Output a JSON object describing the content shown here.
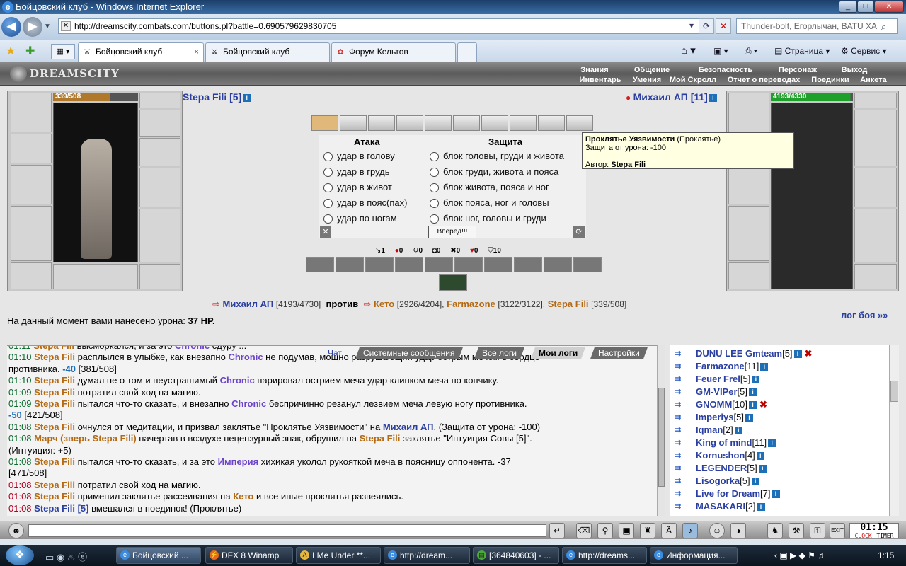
{
  "window": {
    "title": "Бойцовский клуб - Windows Internet Explorer"
  },
  "address": {
    "url": "http://dreamscity.combats.com/buttons.pl?battle=0.690579629830705",
    "search_placeholder": "Thunder-bolt, Егорлычан, BATU ХА"
  },
  "tabs": [
    {
      "label": "Бойцовский клуб",
      "close": "×"
    },
    {
      "label": "Бойцовский клуб"
    },
    {
      "label": "Форум Кельтов"
    }
  ],
  "commands": {
    "page": "Страница",
    "service": "Сервис"
  },
  "game": {
    "logo": "DREAMSCITY",
    "menu_top": [
      "Знания",
      "Общение",
      "Безопасность",
      "Персонаж",
      "Выход"
    ],
    "menu_bottom": [
      "Инвентарь",
      "Умения",
      "Мой Скролл",
      "Отчет о переводах",
      "Поединки",
      "Анкета"
    ],
    "player": {
      "name": "Stepa Fili [5]",
      "hp": "339/508",
      "hp_ratio": 0.667
    },
    "enemy": {
      "name": "Михаил АП [11]",
      "hp": "4193/4330",
      "hp_ratio": 0.968
    },
    "attack_header": "Атака",
    "defense_header": "Защита",
    "attacks": [
      "удар в голову",
      "удар в грудь",
      "удар в живот",
      "удар в пояс(пах)",
      "удар по ногам"
    ],
    "defenses": [
      "блок головы, груди и живота",
      "блок груди, живота и пояса",
      "блок живота, пояса и ног",
      "блок пояса, ног и головы",
      "блок ног, головы и груди"
    ],
    "forward": "Вперёд!!!",
    "stats": [
      "1",
      "0",
      "0",
      "0",
      "0",
      "0",
      "10"
    ],
    "vs": {
      "p1_name": "Михаил АП",
      "p1_hp": "[4193/4730]",
      "versus": "против",
      "p2_name": "Кето",
      "p2_hp": "[2926/4204],",
      "p3_name": "Farmazone",
      "p3_hp": "[3122/3122],",
      "p4_name": "Stepa Fili",
      "p4_hp": "[339/508]"
    },
    "damage_text": "На данный момент вами нанесено урона:",
    "damage_value": "37 HP.",
    "log_link": "лог боя »»",
    "tooltip": {
      "title": "Проклятье Уязвимости",
      "kind": "(Проклятье)",
      "line2": "Защита от урона: -100",
      "author_label": "Автор:",
      "author": "Stepa Fili"
    }
  },
  "chat": {
    "tabs": [
      "Чат",
      "Системные сообщения",
      "Все логи",
      "Мои логи",
      "Настройки"
    ],
    "lines": [
      {
        "time": "01:11",
        "text_a": "Stepa Fili",
        "text_b": " высморкался, и за это ",
        "text_c": "Chronic",
        "text_d": " сдуру ..."
      },
      {
        "time": "01:10",
        "text_a": "Stepa Fili",
        "text_b": " расплылся в улыбке, как внезапно ",
        "text_c": "Chronic",
        "text_d": " не подумав, мощно разрушающий удар острым мечом в сердце"
      },
      {
        "time": "",
        "text_a": "",
        "text_b": "противника. ",
        "text_c": "-40",
        "text_d": " [381/508]"
      },
      {
        "time": "01:10",
        "text_a": "Stepa Fili",
        "text_b": " думал не о том и неустрашимый ",
        "text_c": "Chronic",
        "text_d": " парировал острием меча удар клинком меча по копчику."
      },
      {
        "time": "01:09",
        "text_a": "Stepa Fili",
        "text_b": " потратил свой ход на магию.",
        "text_c": "",
        "text_d": ""
      },
      {
        "time": "01:09",
        "text_a": "Stepa Fili",
        "text_b": " пытался что-то сказать, и внезапно ",
        "text_c": "Chronic",
        "text_d": " беспричинно резанул лезвием меча левую ногу противника."
      },
      {
        "time": "",
        "text_a": "",
        "text_b": "",
        "text_c": "-50",
        "text_d": " [421/508]"
      },
      {
        "time": "01:08",
        "text_a": "Stepa Fili",
        "text_b": " очнулся от медитации, и призвал заклятье \"Проклятье Уязвимости\" на ",
        "text_c": "Михаил АП",
        "text_d": ". (Защита от урона: -100)"
      },
      {
        "time": "01:08",
        "text_a": "Марч (зверь Stepa Fili)",
        "text_b": " начертав в воздухе нецензурный знак, обрушил на ",
        "text_c": "Stepa Fili",
        "text_d": " заклятье \"Интуиция Совы [5]\"."
      },
      {
        "time": "",
        "text_a": "",
        "text_b": "(Интуиция: +5)",
        "text_c": "",
        "text_d": ""
      },
      {
        "time": "01:08",
        "text_a": "Stepa Fili",
        "text_b": " пытался что-то сказать, и за это ",
        "text_c": "Империя",
        "text_d": " хихикая уколол рукояткой меча в поясницу оппонента. -37"
      },
      {
        "time": "",
        "text_a": "",
        "text_b": "[471/508]",
        "text_c": "",
        "text_d": ""
      },
      {
        "time": "01:08",
        "text_a": "Stepa Fili",
        "text_b": " потратил свой ход на магию.",
        "text_c": "",
        "text_d": ""
      },
      {
        "time": "01:08",
        "text_a": "Stepa Fili",
        "text_b": " применил заклятье рассеивания на ",
        "text_c": "Кето",
        "text_d": " и все иные проклятья развеялись."
      },
      {
        "time": "01:08",
        "text_a": "Stepa Fili [5]",
        "text_b": " вмешался в поединок! (Проклятье)",
        "text_c": "",
        "text_d": ""
      }
    ]
  },
  "players": [
    {
      "name": "DUNU LEE Gmteam",
      "level": "[5]",
      "x": true
    },
    {
      "name": "Farmazone",
      "level": "[11]",
      "x": false
    },
    {
      "name": "Feuer Frel",
      "level": "[5]",
      "x": false
    },
    {
      "name": "GM-VIPer",
      "level": "[5]",
      "x": false
    },
    {
      "name": "GNOMM",
      "level": "[10]",
      "x": true
    },
    {
      "name": "Imperiys",
      "level": "[5]",
      "x": false
    },
    {
      "name": "Iqman",
      "level": "[2]",
      "x": false
    },
    {
      "name": "King of mind",
      "level": "[11]",
      "x": false
    },
    {
      "name": "Kornushon",
      "level": "[4]",
      "x": false
    },
    {
      "name": "LEGENDER",
      "level": "[5]",
      "x": false
    },
    {
      "name": "Lisogorka",
      "level": "[5]",
      "x": false
    },
    {
      "name": "Live for Dream",
      "level": "[7]",
      "x": false
    },
    {
      "name": "MASAKARI",
      "level": "[2]",
      "x": false
    }
  ],
  "clock": {
    "time": "01:15",
    "label1": "CLOCK",
    "label2": "TIMER"
  },
  "taskbar": {
    "items": [
      "Бойцовский ...",
      "DFX 8 Winamp",
      "I Me Under **...",
      "http://dream...",
      "[364840603] - ...",
      "http://dreams...",
      "Информация..."
    ],
    "time": "1:15"
  }
}
